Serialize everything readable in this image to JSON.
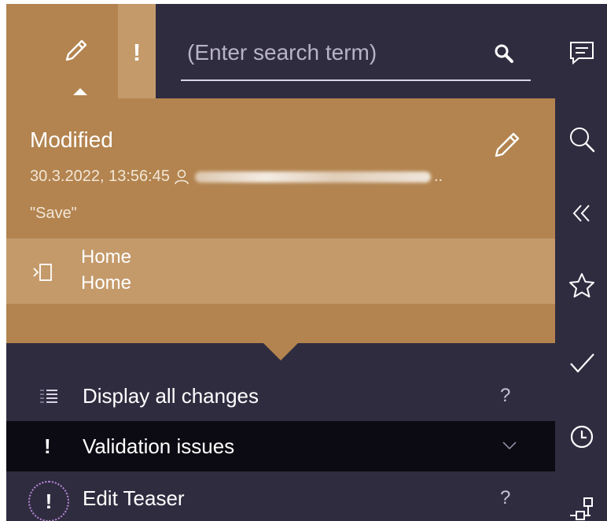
{
  "tabs": {
    "edit": {
      "icon": "pencil-icon"
    },
    "issues": {
      "icon": "exclamation-icon",
      "label": "!"
    }
  },
  "search": {
    "placeholder": "(Enter search term)",
    "value": "",
    "icon": "search-icon"
  },
  "panel": {
    "title": "Modified",
    "timestamp": "30.3.2022, 13:56:45",
    "user_icon": "user-icon",
    "user_suffix": "..",
    "message": "\"Save\"",
    "edit_icon": "pencil-icon",
    "page": {
      "icon": "page-enter-icon",
      "name": "Home",
      "path": "Home"
    }
  },
  "list": {
    "display_changes": {
      "label": "Display all changes",
      "help": "?",
      "icon": "list-icon"
    },
    "validation_issues": {
      "label": "Validation issues",
      "prefix": "!",
      "icon": "chevron-down-icon"
    },
    "edit_teaser": {
      "label": "Edit Teaser",
      "help": "?",
      "prefix": "!"
    }
  },
  "toolbar": {
    "icons": [
      "comment-icon",
      "search-icon",
      "double-chevron-left-icon",
      "star-icon",
      "check-icon",
      "clock-icon",
      "structure-icon"
    ]
  },
  "colors": {
    "background": "#302c40",
    "accent": "#b3844f",
    "accent_light": "#c49a6b",
    "selected_row": "#0c0a12"
  }
}
